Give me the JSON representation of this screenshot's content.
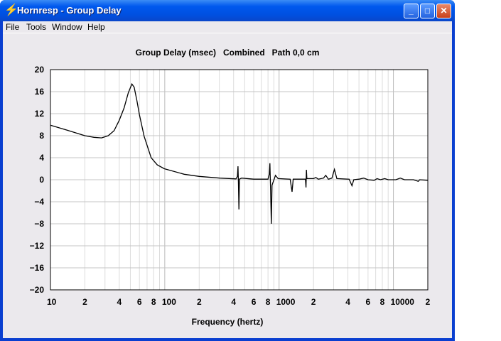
{
  "window": {
    "title": "Hornresp - Group Delay",
    "icon": "lightning-icon"
  },
  "menu": [
    "File",
    "Tools",
    "Window",
    "Help"
  ],
  "chart_data": {
    "type": "line",
    "title": "Group Delay (msec)   Combined   Path 0,0 cm",
    "xlabel": "Frequency (hertz)",
    "ylabel": "",
    "xscale": "log",
    "xlim": [
      10,
      20000
    ],
    "ylim": [
      -20,
      20
    ],
    "grid": true,
    "yticks": [
      20,
      16,
      12,
      8,
      4,
      0,
      -4,
      -8,
      -12,
      -16,
      -20
    ],
    "xticks": [
      {
        "f": 10,
        "label": "10"
      },
      {
        "f": 20,
        "label": "2"
      },
      {
        "f": 40,
        "label": "4"
      },
      {
        "f": 60,
        "label": "6"
      },
      {
        "f": 80,
        "label": "8"
      },
      {
        "f": 100,
        "label": "100"
      },
      {
        "f": 200,
        "label": "2"
      },
      {
        "f": 400,
        "label": "4"
      },
      {
        "f": 600,
        "label": "6"
      },
      {
        "f": 800,
        "label": "8"
      },
      {
        "f": 1000,
        "label": "1000"
      },
      {
        "f": 2000,
        "label": "2"
      },
      {
        "f": 4000,
        "label": "4"
      },
      {
        "f": 6000,
        "label": "6"
      },
      {
        "f": 8000,
        "label": "8"
      },
      {
        "f": 10000,
        "label": "10000"
      },
      {
        "f": 20000,
        "label": "2"
      }
    ],
    "series": [
      {
        "name": "Combined",
        "points": [
          [
            10,
            9.9
          ],
          [
            14,
            9.0
          ],
          [
            20,
            8.0
          ],
          [
            24,
            7.7
          ],
          [
            28,
            7.6
          ],
          [
            32,
            8.0
          ],
          [
            36,
            8.9
          ],
          [
            40,
            10.8
          ],
          [
            44,
            13.0
          ],
          [
            48,
            15.8
          ],
          [
            51.6,
            17.4
          ],
          [
            54,
            16.8
          ],
          [
            57,
            14.4
          ],
          [
            60,
            11.8
          ],
          [
            66,
            7.9
          ],
          [
            76,
            4.0
          ],
          [
            86,
            2.7
          ],
          [
            99,
            2.0
          ],
          [
            148,
            1.0
          ],
          [
            200,
            0.6
          ],
          [
            303,
            0.3
          ],
          [
            420,
            0.15
          ],
          [
            432,
            0.6
          ],
          [
            437,
            2.45
          ],
          [
            441,
            -0.5
          ],
          [
            445,
            -5.4
          ],
          [
            450,
            0.1
          ],
          [
            470,
            0.3
          ],
          [
            600,
            0.1
          ],
          [
            800,
            0.1
          ],
          [
            820,
            1.0
          ],
          [
            831,
            3.0
          ],
          [
            843,
            -2
          ],
          [
            855,
            -8.0
          ],
          [
            868,
            -1
          ],
          [
            880,
            -0.6
          ],
          [
            910,
            0.2
          ],
          [
            930,
            0.8
          ],
          [
            980,
            0.2
          ],
          [
            1250,
            0.1
          ],
          [
            1300,
            -2.2
          ],
          [
            1330,
            0.1
          ],
          [
            1700,
            0.1
          ],
          [
            1720,
            -1.4
          ],
          [
            1735,
            1.8
          ],
          [
            1750,
            0.2
          ],
          [
            2000,
            0.2
          ],
          [
            2100,
            0.4
          ],
          [
            2200,
            0.1
          ],
          [
            2450,
            0.3
          ],
          [
            2560,
            0.8
          ],
          [
            2700,
            0.1
          ],
          [
            2900,
            0.3
          ],
          [
            3050,
            1.9
          ],
          [
            3200,
            0.2
          ],
          [
            4100,
            0.1
          ],
          [
            4340,
            -1.1
          ],
          [
            4500,
            0
          ],
          [
            5000,
            0.1
          ],
          [
            5500,
            0.3
          ],
          [
            6000,
            0
          ],
          [
            6800,
            -0.1
          ],
          [
            7200,
            0.2
          ],
          [
            7700,
            0
          ],
          [
            8400,
            0.2
          ],
          [
            9000,
            0
          ],
          [
            10500,
            0
          ],
          [
            11500,
            0.3
          ],
          [
            12500,
            0
          ],
          [
            15000,
            0
          ],
          [
            16500,
            -0.3
          ],
          [
            17000,
            0
          ],
          [
            20000,
            -0.1
          ]
        ]
      }
    ]
  }
}
